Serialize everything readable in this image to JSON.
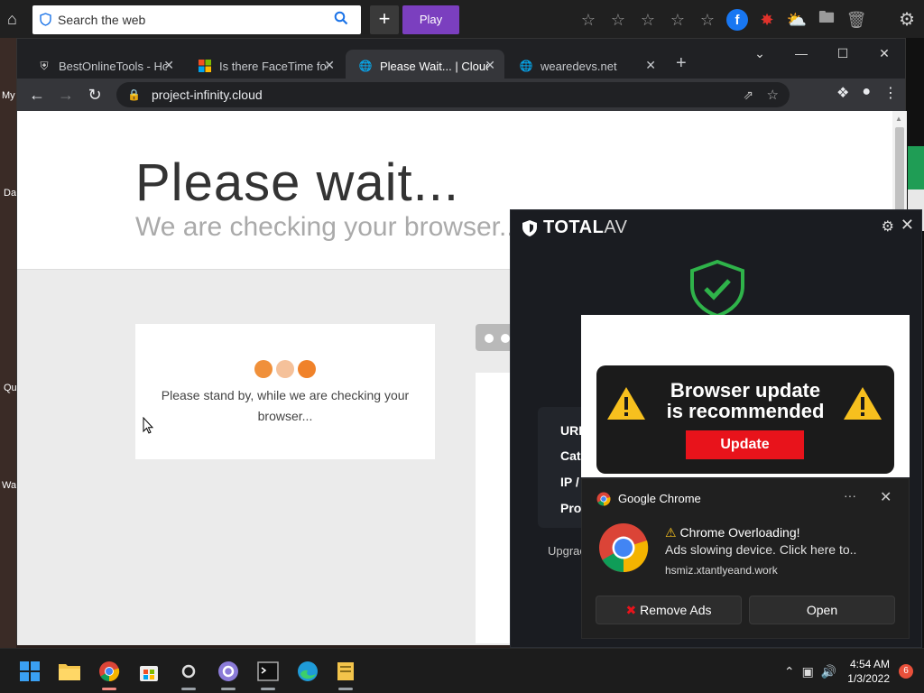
{
  "topbar": {
    "search_placeholder": "Search the web",
    "play_label": "Play",
    "plus_label": "+"
  },
  "desktop": {
    "left_labels": [
      "My",
      "Da",
      "Qu",
      "Wa"
    ]
  },
  "chrome": {
    "tabs": [
      {
        "title": "BestOnlineTools - How",
        "icon": "shield-icon"
      },
      {
        "title": "Is there FaceTime for",
        "icon": "windows-icon"
      },
      {
        "title": "Please Wait... | Cloudf",
        "icon": "globe-icon"
      },
      {
        "title": "wearedevs.net",
        "icon": "globe-icon"
      }
    ],
    "url": "project-infinity.cloud"
  },
  "page": {
    "title": "Please wait...",
    "subtitle": "We are checking your browser... p",
    "card_text": "Please stand by, while we are checking your browser...",
    "dot_colors": [
      "#f0903a",
      "#f5c19a",
      "#f0822a"
    ]
  },
  "totalav": {
    "brand_bold": "TOTAL",
    "brand_light": "AV",
    "rows": [
      "URL",
      "Cate",
      "IP /",
      "Proc"
    ],
    "upgrade": "Upgrac",
    "accent": "#2fb34a"
  },
  "ad": {
    "title_line1": "Browser update",
    "title_line2": "is recommended",
    "button": "Update",
    "button_color": "#e8131b"
  },
  "notification": {
    "app": "Google Chrome",
    "more": "···",
    "title": "Chrome Overloading!",
    "body": "Ads slowing device. Click here to..",
    "url": "hsmiz.xtantlyeand.work",
    "remove_label": "Remove Ads",
    "open_label": "Open"
  },
  "taskbar": {
    "time": "4:54 AM",
    "date": "1/3/2022",
    "badge": "6"
  }
}
